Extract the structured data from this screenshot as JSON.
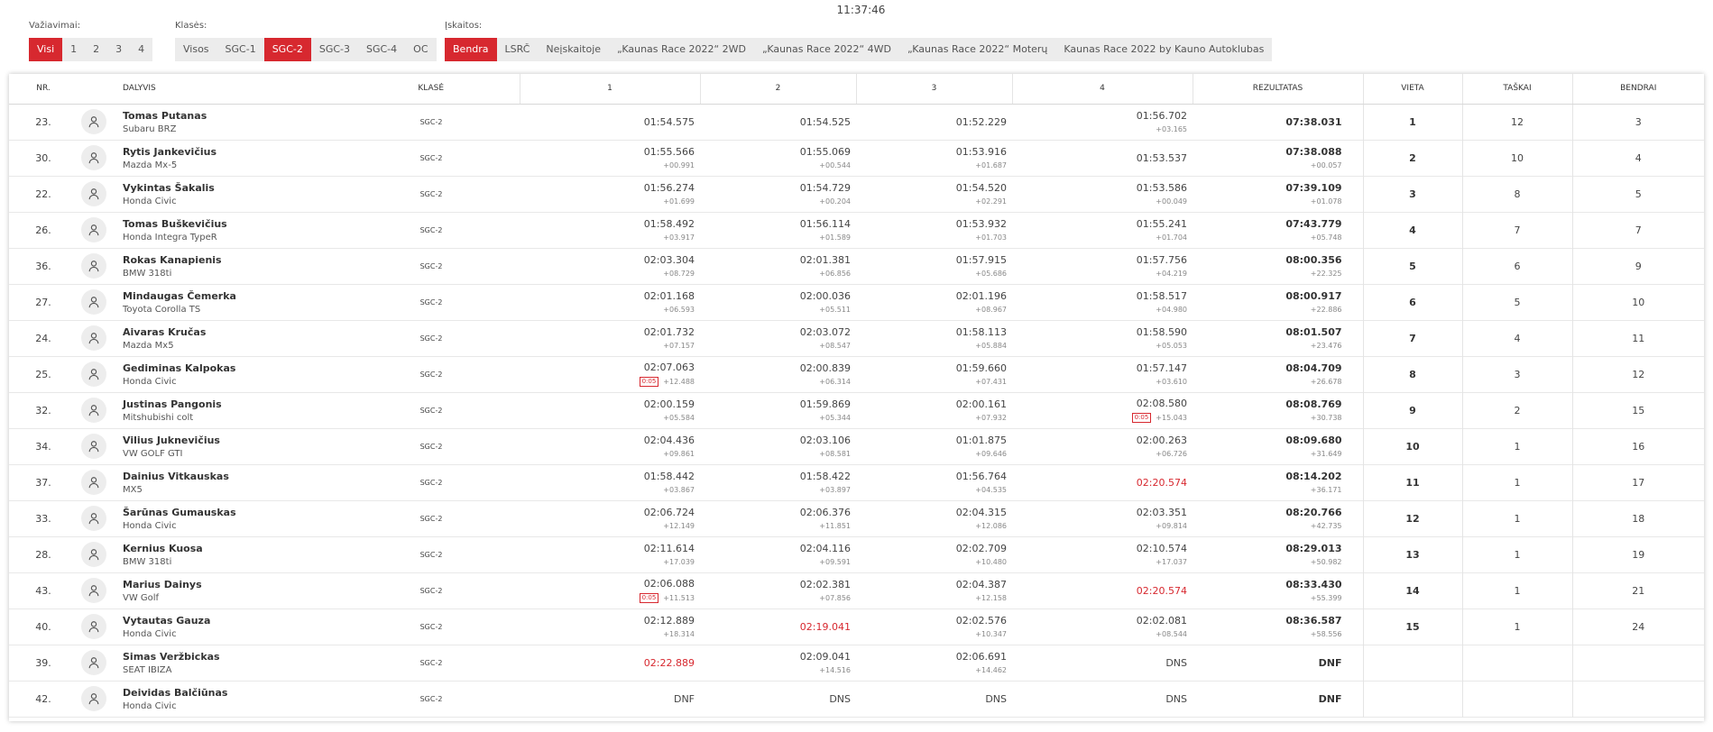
{
  "clock": "11:37:46",
  "filters": {
    "vaziavimai": {
      "label": "Važiavimai:",
      "options": [
        "Visi",
        "1",
        "2",
        "3",
        "4"
      ],
      "active": 0
    },
    "klases": {
      "label": "Klasės:",
      "options": [
        "Visos",
        "SGC-1",
        "SGC-2",
        "SGC-3",
        "SGC-4",
        "OC"
      ],
      "active": 2
    },
    "iskaitos": {
      "label": "Įskaitos:",
      "options": [
        "Bendra",
        "LSRČ",
        "Neįskaitoje",
        "„Kaunas Race 2022“ 2WD",
        "„Kaunas Race 2022“ 4WD",
        "„Kaunas Race 2022“ Moterų",
        "Kaunas Race 2022 by Kauno Autoklubas"
      ],
      "active": 0
    }
  },
  "columns": [
    "NR.",
    "DALYVIS",
    "KLASĖ",
    "1",
    "2",
    "3",
    "4",
    "REZULTATAS",
    "VIETA",
    "TAŠKAI",
    "BENDRAI"
  ],
  "rows": [
    {
      "nr": "23.",
      "name": "Tomas Putanas",
      "car": "Subaru BRZ",
      "cls": "SGC-2",
      "laps": [
        {
          "t": "01:54.575",
          "d": ""
        },
        {
          "t": "01:54.525",
          "d": ""
        },
        {
          "t": "01:52.229",
          "d": ""
        },
        {
          "t": "01:56.702",
          "d": "+03.165"
        }
      ],
      "res": "07:38.031",
      "resd": "",
      "place": "1",
      "pts": "12",
      "tot": "3"
    },
    {
      "nr": "30.",
      "name": "Rytis Jankevičius",
      "car": "Mazda Mx-5",
      "cls": "SGC-2",
      "laps": [
        {
          "t": "01:55.566",
          "d": "+00.991"
        },
        {
          "t": "01:55.069",
          "d": "+00.544"
        },
        {
          "t": "01:53.916",
          "d": "+01.687"
        },
        {
          "t": "01:53.537",
          "d": ""
        }
      ],
      "res": "07:38.088",
      "resd": "+00.057",
      "place": "2",
      "pts": "10",
      "tot": "4"
    },
    {
      "nr": "22.",
      "name": "Vykintas Šakalis",
      "car": "Honda Civic",
      "cls": "SGC-2",
      "laps": [
        {
          "t": "01:56.274",
          "d": "+01.699"
        },
        {
          "t": "01:54.729",
          "d": "+00.204"
        },
        {
          "t": "01:54.520",
          "d": "+02.291"
        },
        {
          "t": "01:53.586",
          "d": "+00.049"
        }
      ],
      "res": "07:39.109",
      "resd": "+01.078",
      "place": "3",
      "pts": "8",
      "tot": "5"
    },
    {
      "nr": "26.",
      "name": "Tomas Buškevičius",
      "car": "Honda Integra TypeR",
      "cls": "SGC-2",
      "laps": [
        {
          "t": "01:58.492",
          "d": "+03.917"
        },
        {
          "t": "01:56.114",
          "d": "+01.589"
        },
        {
          "t": "01:53.932",
          "d": "+01.703"
        },
        {
          "t": "01:55.241",
          "d": "+01.704"
        }
      ],
      "res": "07:43.779",
      "resd": "+05.748",
      "place": "4",
      "pts": "7",
      "tot": "7"
    },
    {
      "nr": "36.",
      "name": "Rokas Kanapienis",
      "car": "BMW 318ti",
      "cls": "SGC-2",
      "laps": [
        {
          "t": "02:03.304",
          "d": "+08.729"
        },
        {
          "t": "02:01.381",
          "d": "+06.856"
        },
        {
          "t": "01:57.915",
          "d": "+05.686"
        },
        {
          "t": "01:57.756",
          "d": "+04.219"
        }
      ],
      "res": "08:00.356",
      "resd": "+22.325",
      "place": "5",
      "pts": "6",
      "tot": "9"
    },
    {
      "nr": "27.",
      "name": "Mindaugas Čemerka",
      "car": "Toyota Corolla TS",
      "cls": "SGC-2",
      "laps": [
        {
          "t": "02:01.168",
          "d": "+06.593"
        },
        {
          "t": "02:00.036",
          "d": "+05.511"
        },
        {
          "t": "02:01.196",
          "d": "+08.967"
        },
        {
          "t": "01:58.517",
          "d": "+04.980"
        }
      ],
      "res": "08:00.917",
      "resd": "+22.886",
      "place": "6",
      "pts": "5",
      "tot": "10"
    },
    {
      "nr": "24.",
      "name": "Aivaras Kručas",
      "car": "Mazda Mx5",
      "cls": "SGC-2",
      "laps": [
        {
          "t": "02:01.732",
          "d": "+07.157"
        },
        {
          "t": "02:03.072",
          "d": "+08.547"
        },
        {
          "t": "01:58.113",
          "d": "+05.884"
        },
        {
          "t": "01:58.590",
          "d": "+05.053"
        }
      ],
      "res": "08:01.507",
      "resd": "+23.476",
      "place": "7",
      "pts": "4",
      "tot": "11"
    },
    {
      "nr": "25.",
      "name": "Gediminas Kalpokas",
      "car": "Honda Civic",
      "cls": "SGC-2",
      "laps": [
        {
          "t": "02:07.063",
          "d": "+12.488",
          "p": "0:05"
        },
        {
          "t": "02:00.839",
          "d": "+06.314"
        },
        {
          "t": "01:59.660",
          "d": "+07.431"
        },
        {
          "t": "01:57.147",
          "d": "+03.610"
        }
      ],
      "res": "08:04.709",
      "resd": "+26.678",
      "place": "8",
      "pts": "3",
      "tot": "12"
    },
    {
      "nr": "32.",
      "name": "Justinas Pangonis",
      "car": "Mitshubishi colt",
      "cls": "SGC-2",
      "laps": [
        {
          "t": "02:00.159",
          "d": "+05.584"
        },
        {
          "t": "01:59.869",
          "d": "+05.344"
        },
        {
          "t": "02:00.161",
          "d": "+07.932"
        },
        {
          "t": "02:08.580",
          "d": "+15.043",
          "p": "0:05"
        }
      ],
      "res": "08:08.769",
      "resd": "+30.738",
      "place": "9",
      "pts": "2",
      "tot": "15"
    },
    {
      "nr": "34.",
      "name": "Vilius Juknevičius",
      "car": "VW GOLF GTI",
      "cls": "SGC-2",
      "laps": [
        {
          "t": "02:04.436",
          "d": "+09.861"
        },
        {
          "t": "02:03.106",
          "d": "+08.581"
        },
        {
          "t": "01:01.875",
          "d": "+09.646"
        },
        {
          "t": "02:00.263",
          "d": "+06.726"
        }
      ],
      "res": "08:09.680",
      "resd": "+31.649",
      "place": "10",
      "pts": "1",
      "tot": "16"
    },
    {
      "nr": "37.",
      "name": "Dainius Vitkauskas",
      "car": "MX5",
      "cls": "SGC-2",
      "laps": [
        {
          "t": "01:58.442",
          "d": "+03.867"
        },
        {
          "t": "01:58.422",
          "d": "+03.897"
        },
        {
          "t": "01:56.764",
          "d": "+04.535"
        },
        {
          "t": "02:20.574",
          "d": "",
          "red": true
        }
      ],
      "res": "08:14.202",
      "resd": "+36.171",
      "place": "11",
      "pts": "1",
      "tot": "17"
    },
    {
      "nr": "33.",
      "name": "Šarūnas Gumauskas",
      "car": "Honda Civic",
      "cls": "SGC-2",
      "laps": [
        {
          "t": "02:06.724",
          "d": "+12.149"
        },
        {
          "t": "02:06.376",
          "d": "+11.851"
        },
        {
          "t": "02:04.315",
          "d": "+12.086"
        },
        {
          "t": "02:03.351",
          "d": "+09.814"
        }
      ],
      "res": "08:20.766",
      "resd": "+42.735",
      "place": "12",
      "pts": "1",
      "tot": "18"
    },
    {
      "nr": "28.",
      "name": "Kernius Kuosa",
      "car": "BMW 318ti",
      "cls": "SGC-2",
      "laps": [
        {
          "t": "02:11.614",
          "d": "+17.039"
        },
        {
          "t": "02:04.116",
          "d": "+09.591"
        },
        {
          "t": "02:02.709",
          "d": "+10.480"
        },
        {
          "t": "02:10.574",
          "d": "+17.037"
        }
      ],
      "res": "08:29.013",
      "resd": "+50.982",
      "place": "13",
      "pts": "1",
      "tot": "19"
    },
    {
      "nr": "43.",
      "name": "Marius Dainys",
      "car": "VW Golf",
      "cls": "SGC-2",
      "laps": [
        {
          "t": "02:06.088",
          "d": "+11.513",
          "p": "0:05"
        },
        {
          "t": "02:02.381",
          "d": "+07.856"
        },
        {
          "t": "02:04.387",
          "d": "+12.158"
        },
        {
          "t": "02:20.574",
          "d": "",
          "red": true
        }
      ],
      "res": "08:33.430",
      "resd": "+55.399",
      "place": "14",
      "pts": "1",
      "tot": "21"
    },
    {
      "nr": "40.",
      "name": "Vytautas Gauza",
      "car": "Honda Civic",
      "cls": "SGC-2",
      "laps": [
        {
          "t": "02:12.889",
          "d": "+18.314"
        },
        {
          "t": "02:19.041",
          "d": "",
          "red": true
        },
        {
          "t": "02:02.576",
          "d": "+10.347"
        },
        {
          "t": "02:02.081",
          "d": "+08.544"
        }
      ],
      "res": "08:36.587",
      "resd": "+58.556",
      "place": "15",
      "pts": "1",
      "tot": "24"
    },
    {
      "nr": "39.",
      "name": "Simas Veržbickas",
      "car": "SEAT IBIZA",
      "cls": "SGC-2",
      "laps": [
        {
          "t": "02:22.889",
          "d": "",
          "red": true
        },
        {
          "t": "02:09.041",
          "d": "+14.516"
        },
        {
          "t": "02:06.691",
          "d": "+14.462"
        },
        {
          "t": "DNS",
          "d": ""
        }
      ],
      "res": "DNF",
      "resd": "",
      "place": "",
      "pts": "",
      "tot": ""
    },
    {
      "nr": "42.",
      "name": "Deividas Balčiūnas",
      "car": "Honda Civic",
      "cls": "SGC-2",
      "laps": [
        {
          "t": "DNF",
          "d": ""
        },
        {
          "t": "DNS",
          "d": ""
        },
        {
          "t": "DNS",
          "d": ""
        },
        {
          "t": "DNS",
          "d": ""
        }
      ],
      "res": "DNF",
      "resd": "",
      "place": "",
      "pts": "",
      "tot": ""
    }
  ]
}
